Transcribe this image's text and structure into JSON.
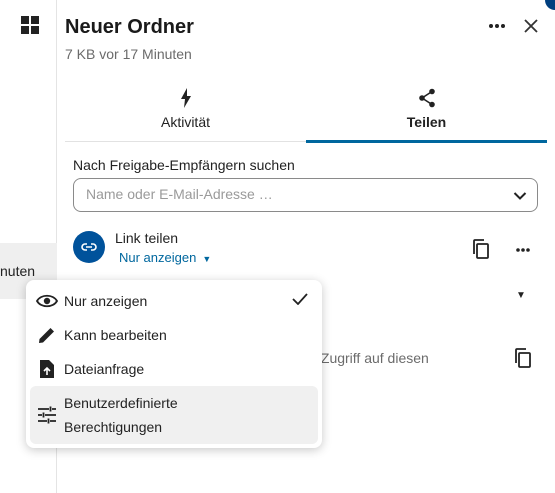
{
  "left": {
    "row_text": "nuten"
  },
  "header": {
    "title": "Neuer Ordner",
    "subtitle": "7 KB vor 17 Minuten"
  },
  "tabs": [
    {
      "label": "Aktivität",
      "icon": "lightning-icon",
      "active": false
    },
    {
      "label": "Teilen",
      "icon": "share-icon",
      "active": true
    }
  ],
  "search": {
    "label": "Nach Freigabe-Empfängern suchen",
    "placeholder": "Name oder E-Mail-Adresse …",
    "value": ""
  },
  "link_share": {
    "title": "Link teilen",
    "permission": "Nur anzeigen"
  },
  "partial_text": "it Zugriff auf diesen",
  "menu": {
    "items": [
      {
        "label": "Nur anzeigen",
        "icon": "eye-icon",
        "selected": true
      },
      {
        "label": "Kann bearbeiten",
        "icon": "pencil-icon",
        "selected": false
      },
      {
        "label": "Dateianfrage",
        "icon": "file-upload-icon",
        "selected": false
      },
      {
        "label_line1": "Benutzerdefinierte",
        "label_line2": "Berechtigungen",
        "icon": "tune-icon",
        "selected": false
      }
    ]
  },
  "colors": {
    "accent": "#00679e",
    "avatar": "#00529b"
  }
}
